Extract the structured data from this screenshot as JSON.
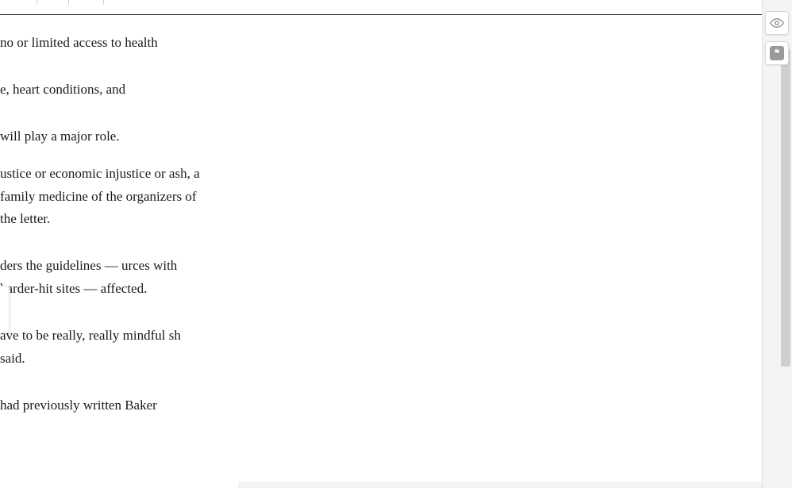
{
  "article": {
    "p1": "no or limited access to health",
    "p2": "e, heart conditions, and",
    "p3": " will play a major role.",
    "p4": "ustice or economic injustice or ash, a family medicine of the organizers of the letter.",
    "p5": "ders the guidelines — urces with harder-hit sites —  affected.",
    "p6": "ave to be really, really mindful sh said.",
    "p7": " had previously written Baker"
  },
  "floating": {
    "quote_glyph": "❝"
  },
  "divider_positions": [
    46,
    86,
    130
  ]
}
